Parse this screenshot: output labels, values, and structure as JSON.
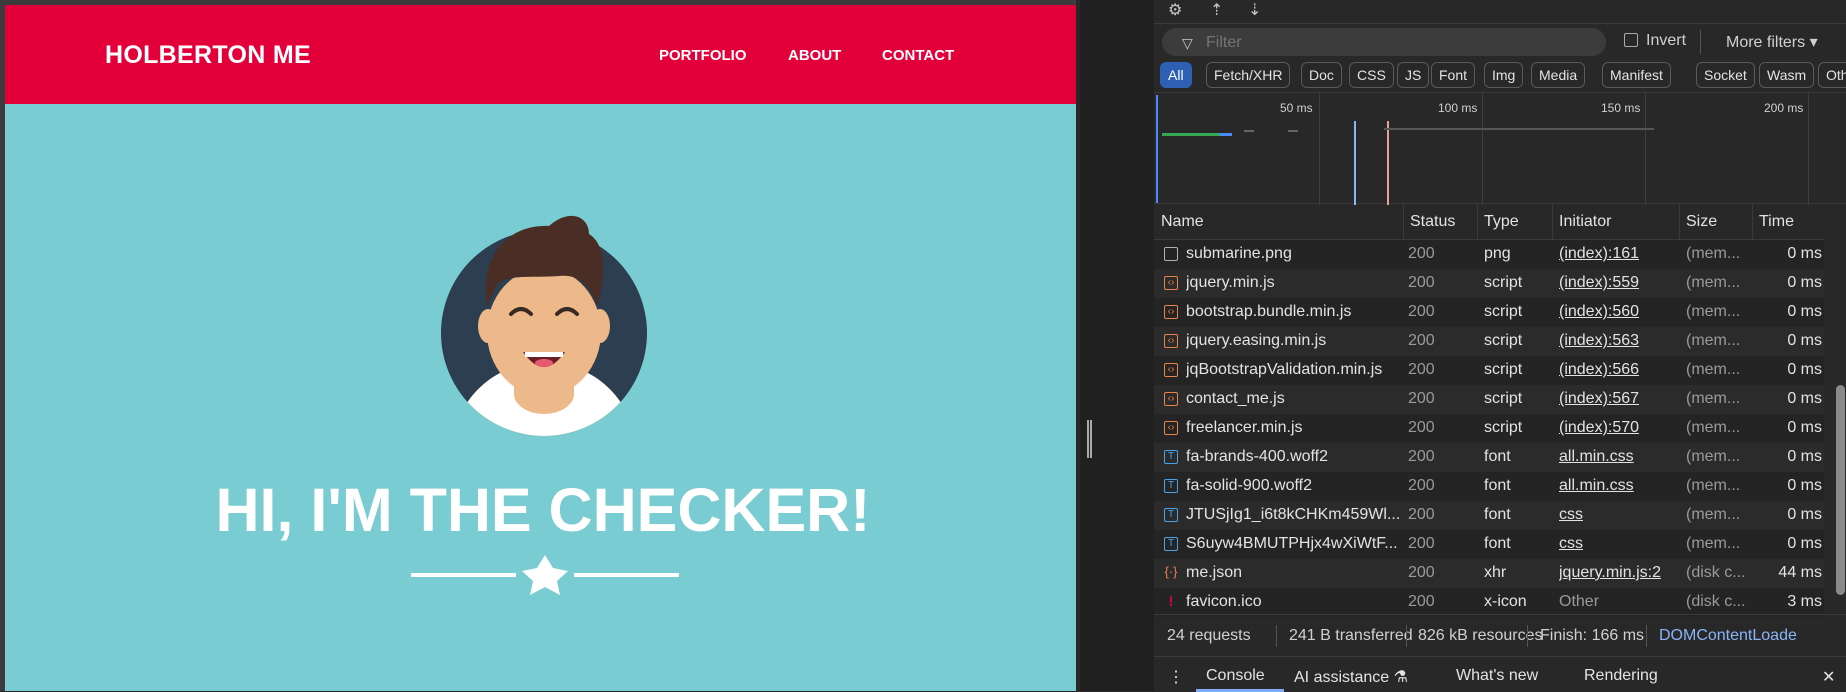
{
  "website": {
    "brand": "HOLBERTON ME",
    "nav": [
      "PORTFOLIO",
      "ABOUT",
      "CONTACT"
    ],
    "hero_title": "HI, I'M THE CHECKER!",
    "colors": {
      "navbar": "#e3003a",
      "hero_bg": "#79ccd1"
    }
  },
  "devtools": {
    "filter_placeholder": "Filter",
    "invert_label": "Invert",
    "more_filters": "More filters",
    "type_filters": [
      "All",
      "Fetch/XHR",
      "Doc",
      "CSS",
      "JS",
      "Font",
      "Img",
      "Media",
      "Manifest",
      "Socket",
      "Wasm",
      "Oth"
    ],
    "active_type": "All",
    "timeline_ticks": [
      "50 ms",
      "100 ms",
      "150 ms",
      "200 ms"
    ],
    "columns": [
      "Name",
      "Status",
      "Type",
      "Initiator",
      "Size",
      "Time"
    ],
    "requests": [
      {
        "name": "submarine.png",
        "status": "200",
        "type": "png",
        "initiator": "(index):161",
        "size": "(mem...",
        "time": "0 ms",
        "icon": "image-icon"
      },
      {
        "name": "jquery.min.js",
        "status": "200",
        "type": "script",
        "initiator": "(index):559",
        "size": "(mem...",
        "time": "0 ms",
        "icon": "script-icon"
      },
      {
        "name": "bootstrap.bundle.min.js",
        "status": "200",
        "type": "script",
        "initiator": "(index):560",
        "size": "(mem...",
        "time": "0 ms",
        "icon": "script-icon"
      },
      {
        "name": "jquery.easing.min.js",
        "status": "200",
        "type": "script",
        "initiator": "(index):563",
        "size": "(mem...",
        "time": "0 ms",
        "icon": "script-icon"
      },
      {
        "name": "jqBootstrapValidation.min.js",
        "status": "200",
        "type": "script",
        "initiator": "(index):566",
        "size": "(mem...",
        "time": "0 ms",
        "icon": "script-icon"
      },
      {
        "name": "contact_me.js",
        "status": "200",
        "type": "script",
        "initiator": "(index):567",
        "size": "(mem...",
        "time": "0 ms",
        "icon": "script-icon"
      },
      {
        "name": "freelancer.min.js",
        "status": "200",
        "type": "script",
        "initiator": "(index):570",
        "size": "(mem...",
        "time": "0 ms",
        "icon": "script-icon"
      },
      {
        "name": "fa-brands-400.woff2",
        "status": "200",
        "type": "font",
        "initiator": "all.min.css",
        "size": "(mem...",
        "time": "0 ms",
        "icon": "font-icon"
      },
      {
        "name": "fa-solid-900.woff2",
        "status": "200",
        "type": "font",
        "initiator": "all.min.css",
        "size": "(mem...",
        "time": "0 ms",
        "icon": "font-icon"
      },
      {
        "name": "JTUSjIg1_i6t8kCHKm459Wl...",
        "status": "200",
        "type": "font",
        "initiator": "css",
        "size": "(mem...",
        "time": "0 ms",
        "icon": "font-icon"
      },
      {
        "name": "S6uyw4BMUTPHjx4wXiWtF...",
        "status": "200",
        "type": "font",
        "initiator": "css",
        "size": "(mem...",
        "time": "0 ms",
        "icon": "font-icon"
      },
      {
        "name": "me.json",
        "status": "200",
        "type": "xhr",
        "initiator": "jquery.min.js:2",
        "size": "(disk c...",
        "time": "44 ms",
        "icon": "xhr-icon"
      },
      {
        "name": "favicon.ico",
        "status": "200",
        "type": "x-icon",
        "initiator": "Other",
        "size": "(disk c...",
        "time": "3 ms",
        "icon": "favicon-icon"
      }
    ],
    "status_bar": {
      "requests": "24 requests",
      "transferred": "241 B transferred",
      "resources": "826 kB resources",
      "finish": "Finish: 166 ms",
      "dom_loaded": "DOMContentLoade"
    },
    "drawer_tabs": [
      "Console",
      "AI assistance",
      "What's new",
      "Rendering"
    ]
  }
}
